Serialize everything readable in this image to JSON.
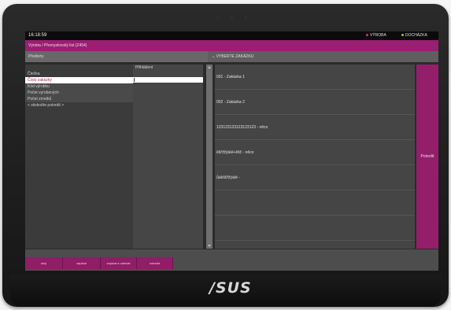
{
  "header": {
    "time": "16:18:59",
    "status": [
      {
        "label": "VÝROBA",
        "color": "#cc2f86"
      },
      {
        "label": "DOCHÁZKA",
        "color": "#8bcf2e"
      }
    ]
  },
  "breadcrumb": "Výroba / Přemyslovský list (Z454)",
  "left_panel": {
    "header": "Předlohy",
    "column_title": "Přihlášení",
    "items": [
      {
        "label": "Čtečka"
      },
      {
        "label": "Číslo zakázky"
      },
      {
        "label": "Kód výrobku"
      },
      {
        "label": "Počet vyrobených"
      },
      {
        "label": "Počet zmetků"
      },
      {
        "label": "< stiskněte potvrdit >"
      }
    ]
  },
  "right_panel": {
    "header": "VYBERTE ZAKÁZKU",
    "options": [
      "001 - Zakázka 1",
      "002 - Zakázka 2",
      "123123123123123123 - něco",
      "ěščřžýáíé+ěšč - něco",
      "ůúěščřžýáíé - "
    ],
    "confirm_label": "Potvrdit"
  },
  "bottom_buttons": [
    "skrý",
    "zapisat",
    "zapisat a odeslat",
    "odeslat"
  ],
  "brand": "/SUS"
}
